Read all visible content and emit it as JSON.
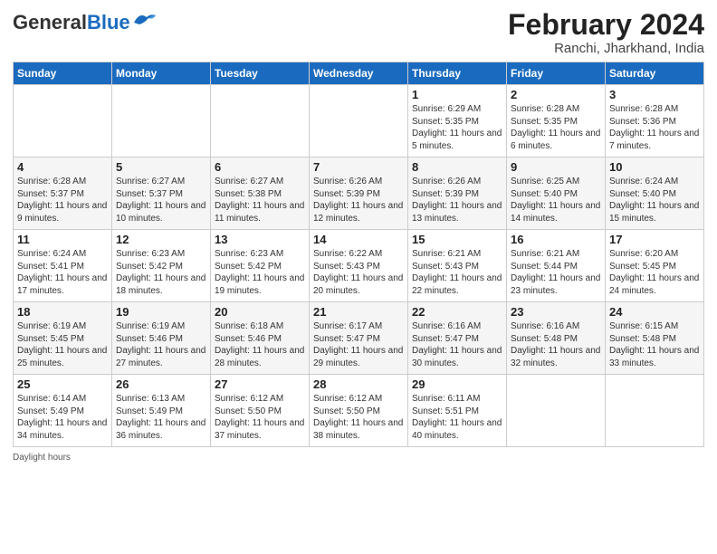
{
  "header": {
    "logo_general": "General",
    "logo_blue": "Blue",
    "title": "February 2024",
    "subtitle": "Ranchi, Jharkhand, India"
  },
  "weekdays": [
    "Sunday",
    "Monday",
    "Tuesday",
    "Wednesday",
    "Thursday",
    "Friday",
    "Saturday"
  ],
  "weeks": [
    [
      {
        "day": "",
        "info": ""
      },
      {
        "day": "",
        "info": ""
      },
      {
        "day": "",
        "info": ""
      },
      {
        "day": "",
        "info": ""
      },
      {
        "day": "1",
        "info": "Sunrise: 6:29 AM\nSunset: 5:35 PM\nDaylight: 11 hours and 5 minutes."
      },
      {
        "day": "2",
        "info": "Sunrise: 6:28 AM\nSunset: 5:35 PM\nDaylight: 11 hours and 6 minutes."
      },
      {
        "day": "3",
        "info": "Sunrise: 6:28 AM\nSunset: 5:36 PM\nDaylight: 11 hours and 7 minutes."
      }
    ],
    [
      {
        "day": "4",
        "info": "Sunrise: 6:28 AM\nSunset: 5:37 PM\nDaylight: 11 hours and 9 minutes."
      },
      {
        "day": "5",
        "info": "Sunrise: 6:27 AM\nSunset: 5:37 PM\nDaylight: 11 hours and 10 minutes."
      },
      {
        "day": "6",
        "info": "Sunrise: 6:27 AM\nSunset: 5:38 PM\nDaylight: 11 hours and 11 minutes."
      },
      {
        "day": "7",
        "info": "Sunrise: 6:26 AM\nSunset: 5:39 PM\nDaylight: 11 hours and 12 minutes."
      },
      {
        "day": "8",
        "info": "Sunrise: 6:26 AM\nSunset: 5:39 PM\nDaylight: 11 hours and 13 minutes."
      },
      {
        "day": "9",
        "info": "Sunrise: 6:25 AM\nSunset: 5:40 PM\nDaylight: 11 hours and 14 minutes."
      },
      {
        "day": "10",
        "info": "Sunrise: 6:24 AM\nSunset: 5:40 PM\nDaylight: 11 hours and 15 minutes."
      }
    ],
    [
      {
        "day": "11",
        "info": "Sunrise: 6:24 AM\nSunset: 5:41 PM\nDaylight: 11 hours and 17 minutes."
      },
      {
        "day": "12",
        "info": "Sunrise: 6:23 AM\nSunset: 5:42 PM\nDaylight: 11 hours and 18 minutes."
      },
      {
        "day": "13",
        "info": "Sunrise: 6:23 AM\nSunset: 5:42 PM\nDaylight: 11 hours and 19 minutes."
      },
      {
        "day": "14",
        "info": "Sunrise: 6:22 AM\nSunset: 5:43 PM\nDaylight: 11 hours and 20 minutes."
      },
      {
        "day": "15",
        "info": "Sunrise: 6:21 AM\nSunset: 5:43 PM\nDaylight: 11 hours and 22 minutes."
      },
      {
        "day": "16",
        "info": "Sunrise: 6:21 AM\nSunset: 5:44 PM\nDaylight: 11 hours and 23 minutes."
      },
      {
        "day": "17",
        "info": "Sunrise: 6:20 AM\nSunset: 5:45 PM\nDaylight: 11 hours and 24 minutes."
      }
    ],
    [
      {
        "day": "18",
        "info": "Sunrise: 6:19 AM\nSunset: 5:45 PM\nDaylight: 11 hours and 25 minutes."
      },
      {
        "day": "19",
        "info": "Sunrise: 6:19 AM\nSunset: 5:46 PM\nDaylight: 11 hours and 27 minutes."
      },
      {
        "day": "20",
        "info": "Sunrise: 6:18 AM\nSunset: 5:46 PM\nDaylight: 11 hours and 28 minutes."
      },
      {
        "day": "21",
        "info": "Sunrise: 6:17 AM\nSunset: 5:47 PM\nDaylight: 11 hours and 29 minutes."
      },
      {
        "day": "22",
        "info": "Sunrise: 6:16 AM\nSunset: 5:47 PM\nDaylight: 11 hours and 30 minutes."
      },
      {
        "day": "23",
        "info": "Sunrise: 6:16 AM\nSunset: 5:48 PM\nDaylight: 11 hours and 32 minutes."
      },
      {
        "day": "24",
        "info": "Sunrise: 6:15 AM\nSunset: 5:48 PM\nDaylight: 11 hours and 33 minutes."
      }
    ],
    [
      {
        "day": "25",
        "info": "Sunrise: 6:14 AM\nSunset: 5:49 PM\nDaylight: 11 hours and 34 minutes."
      },
      {
        "day": "26",
        "info": "Sunrise: 6:13 AM\nSunset: 5:49 PM\nDaylight: 11 hours and 36 minutes."
      },
      {
        "day": "27",
        "info": "Sunrise: 6:12 AM\nSunset: 5:50 PM\nDaylight: 11 hours and 37 minutes."
      },
      {
        "day": "28",
        "info": "Sunrise: 6:12 AM\nSunset: 5:50 PM\nDaylight: 11 hours and 38 minutes."
      },
      {
        "day": "29",
        "info": "Sunrise: 6:11 AM\nSunset: 5:51 PM\nDaylight: 11 hours and 40 minutes."
      },
      {
        "day": "",
        "info": ""
      },
      {
        "day": "",
        "info": ""
      }
    ]
  ],
  "footer": {
    "daylight_label": "Daylight hours"
  }
}
